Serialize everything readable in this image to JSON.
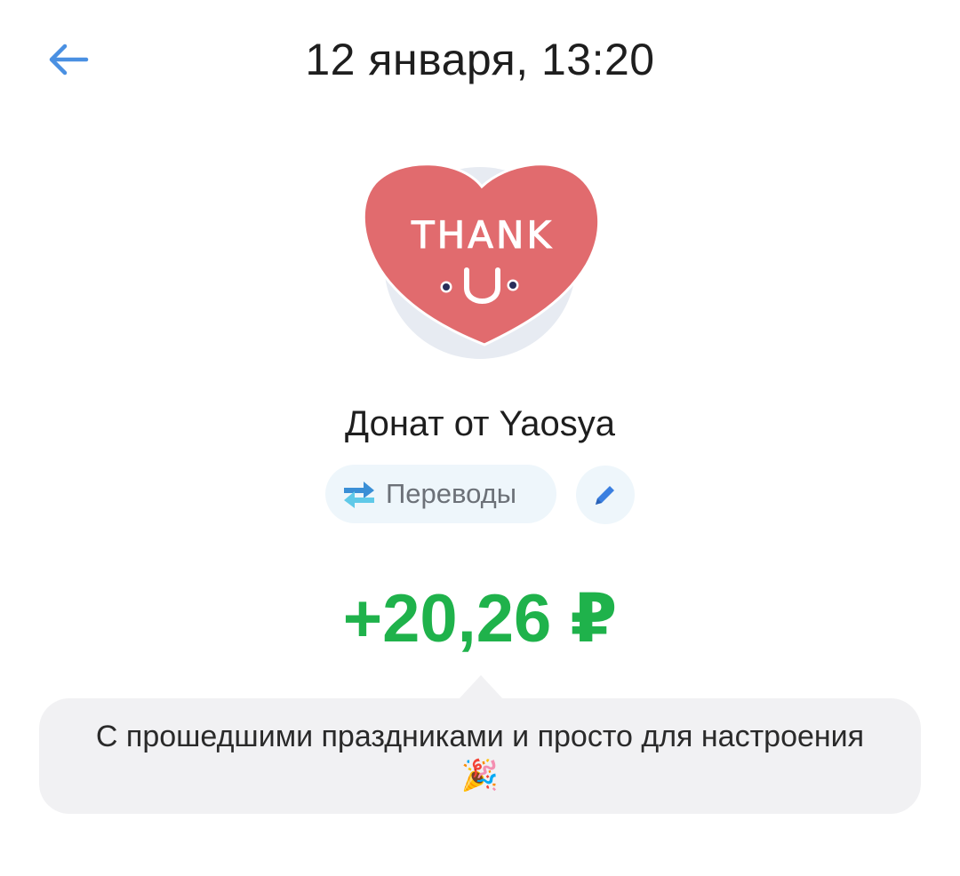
{
  "header": {
    "title": "12 января, 13:20",
    "back_icon": "arrow-left-icon"
  },
  "sticker": {
    "icon": "thank-u-heart-sticker",
    "text_line1": "THANK",
    "text_line2": "U"
  },
  "transaction": {
    "title": "Донат от Yaosya",
    "category": {
      "label": "Переводы",
      "icon": "transfer-arrows-icon"
    },
    "edit_icon": "pencil-icon",
    "amount": "+20,26 ₽",
    "message": "С прошедшими праздниками и просто для настроения🎉"
  },
  "colors": {
    "accent_blue": "#4a90e2",
    "amount_green": "#1fb24b",
    "heart_red": "#e16b6e",
    "chip_bg": "#eef6fb",
    "bubble_bg": "#f1f1f3"
  }
}
